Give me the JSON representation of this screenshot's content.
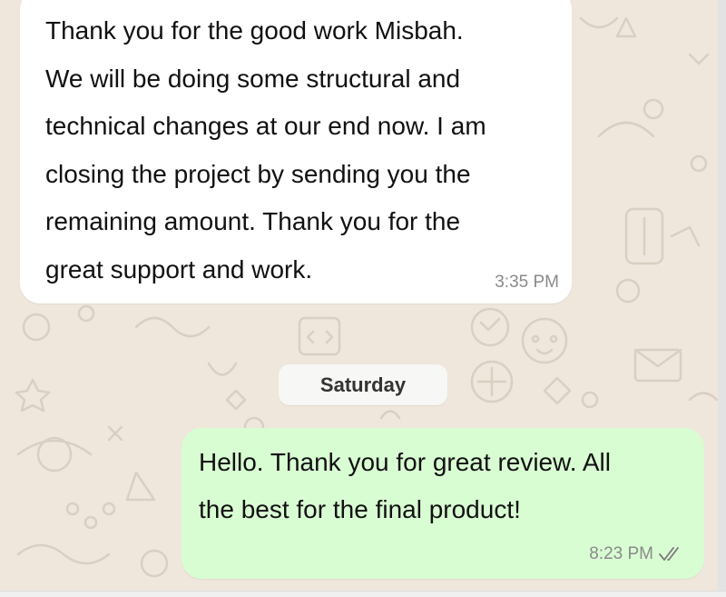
{
  "chat": {
    "incoming": {
      "lines": [
        "Thank you for the good work Misbah.",
        "We will be doing some structural and",
        "technical changes at our end now. I am",
        "closing the project by sending you the",
        "remaining amount. Thank you for the",
        "great support and work."
      ],
      "time": "3:35 PM"
    },
    "day_separator": "Saturday",
    "outgoing": {
      "lines": [
        "Hello. Thank you for great review.  All",
        "the best for the final product!"
      ],
      "time": "8:23 PM",
      "status_icon": "double-check-icon"
    }
  },
  "colors": {
    "wallpaper": "#efe7dc",
    "incoming_bubble": "#ffffff",
    "outgoing_bubble": "#d9fdd3",
    "timestamp": "#8a8a8a"
  }
}
